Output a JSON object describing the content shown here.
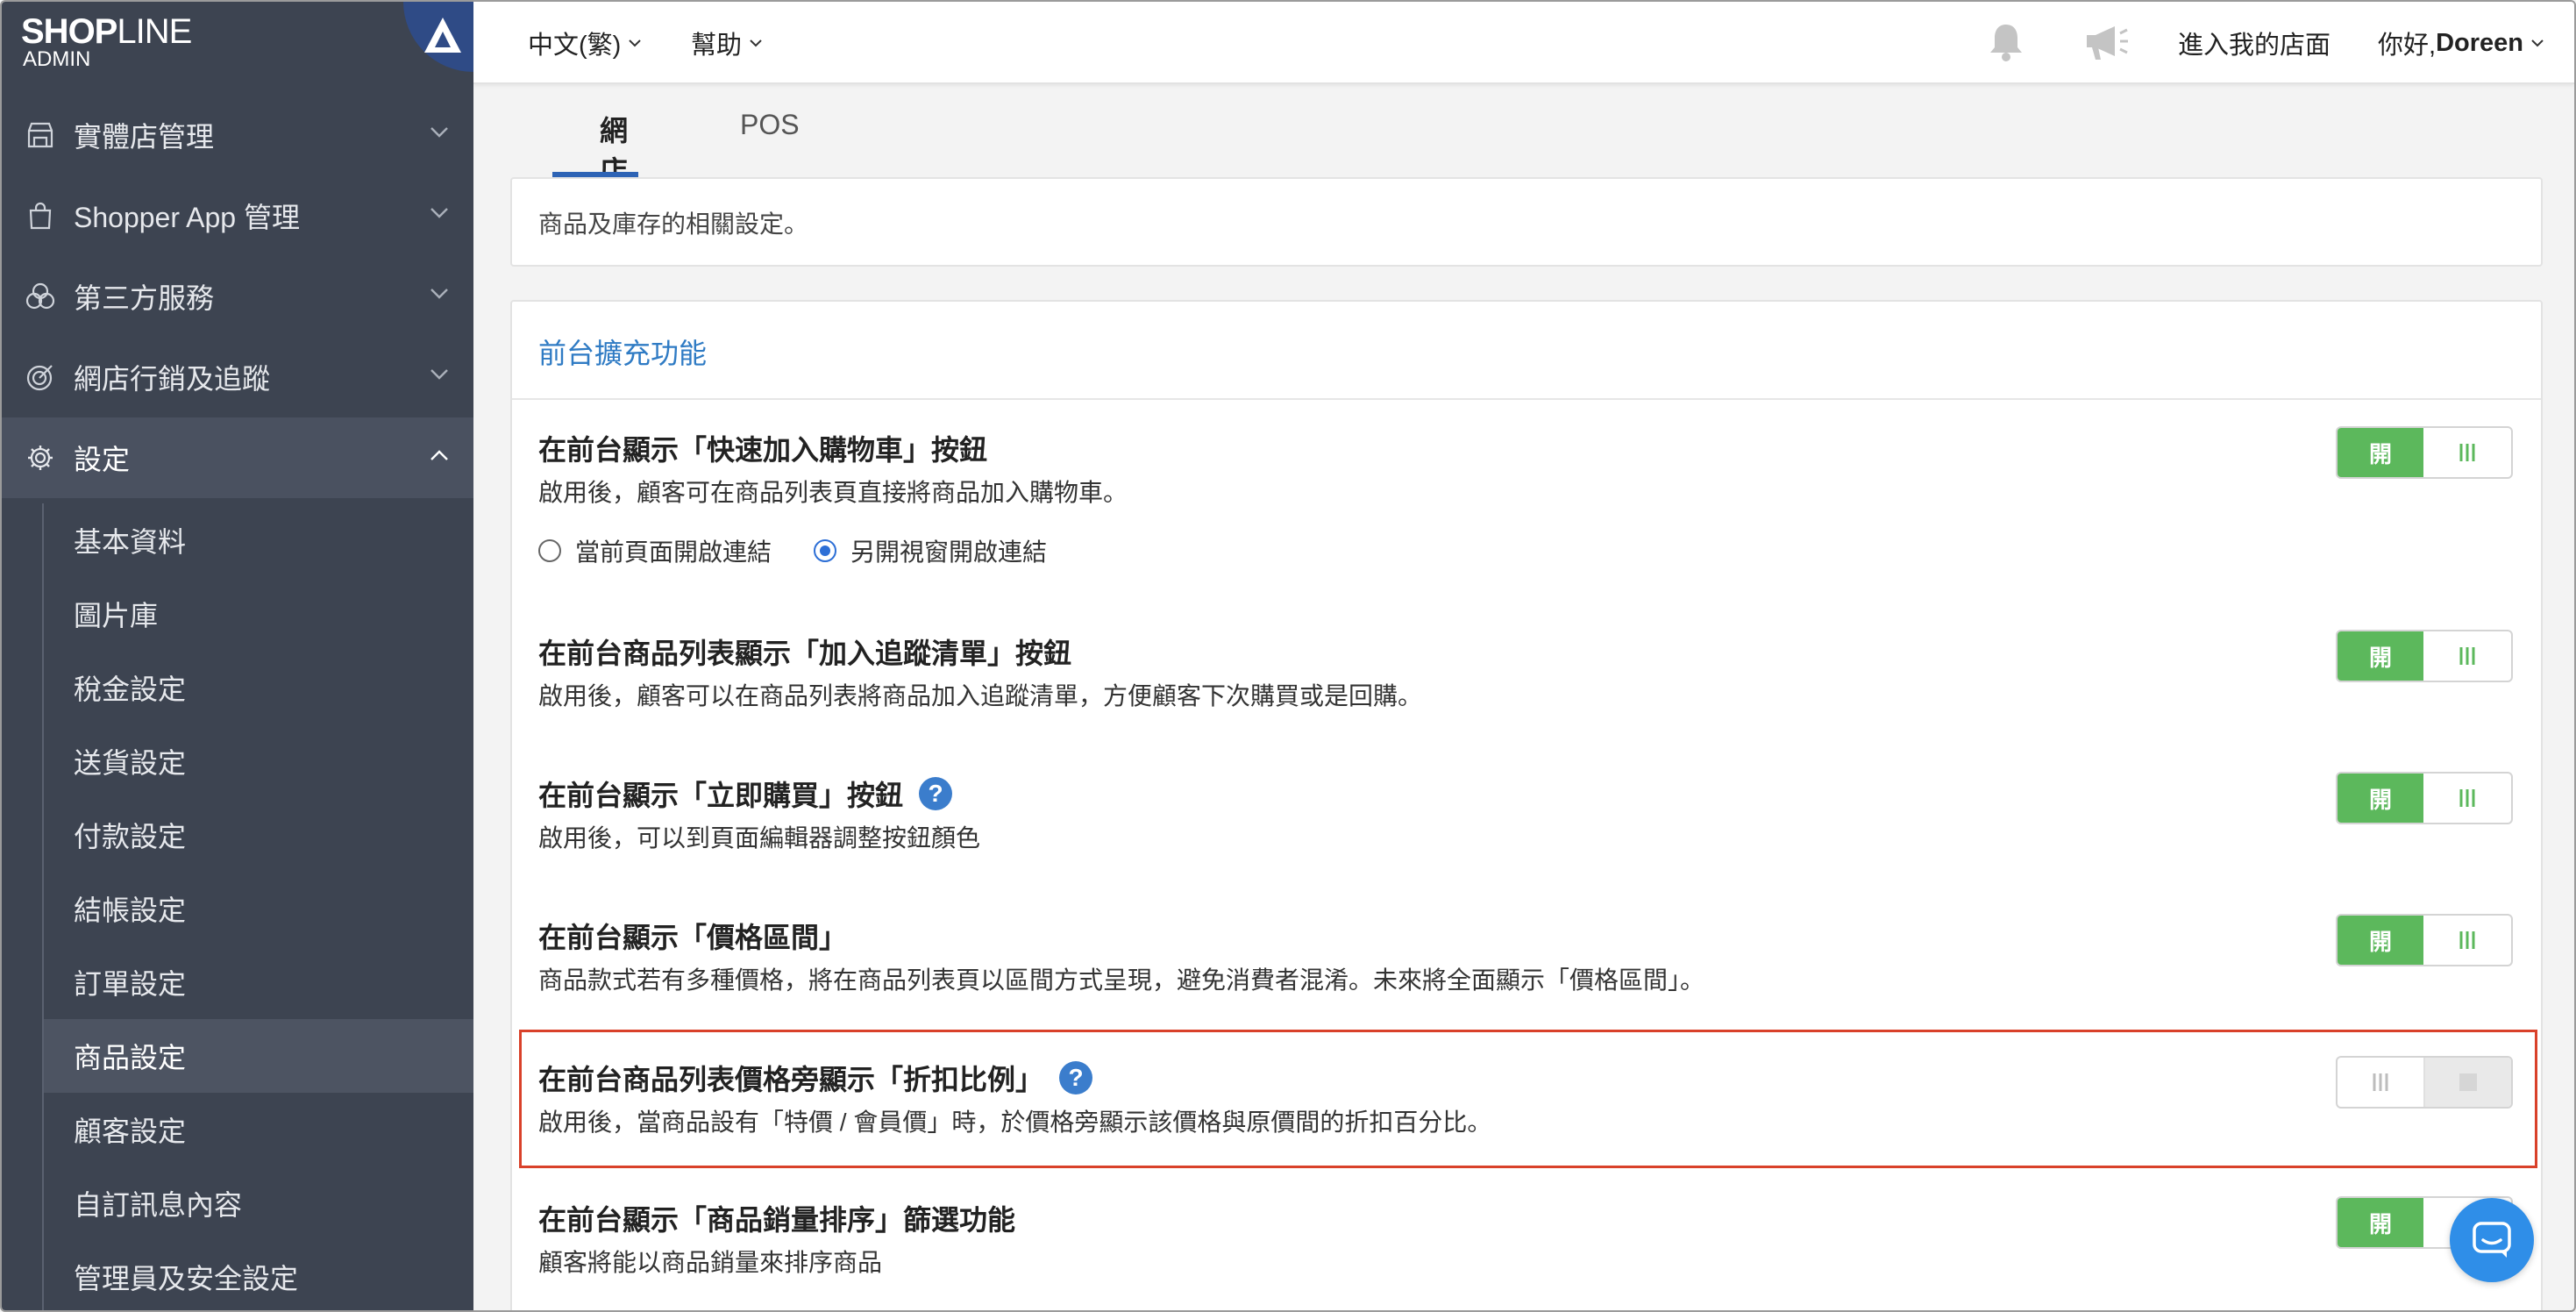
{
  "brand": {
    "logo_bold": "SHOP",
    "logo_light": "LINE",
    "logo_sub": "ADMIN",
    "brand_color": "#2f4b86"
  },
  "sidebar": {
    "items": [
      {
        "label": "實體店管理",
        "icon": "store-icon"
      },
      {
        "label": "Shopper App 管理",
        "icon": "shopping-bag-icon"
      },
      {
        "label": "第三方服務",
        "icon": "overlapping-circles-icon"
      },
      {
        "label": "網店行銷及追蹤",
        "icon": "target-icon"
      },
      {
        "label": "設定",
        "icon": "gear-icon"
      }
    ],
    "sub_items": [
      "基本資料",
      "圖片庫",
      "稅金設定",
      "送貨設定",
      "付款設定",
      "結帳設定",
      "訂單設定",
      "商品設定",
      "顧客設定",
      "自訂訊息內容",
      "管理員及安全設定"
    ],
    "active_sub": "商品設定"
  },
  "topbar": {
    "language": "中文(繁)",
    "help": "幫助",
    "enter_store": "進入我的店面",
    "greeting": "你好, ",
    "user_name": "Doreen"
  },
  "tabs": {
    "online": "網店",
    "pos": "POS"
  },
  "description": "商品及庫存的相關設定。",
  "section": {
    "title": "前台擴充功能",
    "rows": [
      {
        "title": "在前台顯示「快速加入購物車」按鈕",
        "desc": "啟用後，顧客可在商品列表頁直接將商品加入購物車。",
        "enabled": true
      },
      {
        "title": "在前台商品列表顯示「加入追蹤清單」按鈕",
        "desc": "啟用後，顧客可以在商品列表將商品加入追蹤清單，方便顧客下次購買或是回購。",
        "enabled": true
      },
      {
        "title": "在前台顯示「立即購買」按鈕",
        "desc": "啟用後，可以到頁面編輯器調整按鈕顏色",
        "enabled": true
      },
      {
        "title": "在前台顯示「價格區間」",
        "desc": "商品款式若有多種價格，將在商品列表頁以區間方式呈現，避免消費者混淆。未來將全面顯示「價格區間」。",
        "enabled": true
      },
      {
        "title": "在前台商品列表價格旁顯示「折扣比例」",
        "desc": "啟用後，當商品設有「特價 / 會員價」時，於價格旁顯示該價格與原價間的折扣百分比。",
        "enabled": false
      },
      {
        "title": "在前台顯示「商品銷量排序」篩選功能",
        "desc": "顧客將能以商品銷量來排序商品",
        "enabled": true
      }
    ],
    "radio": {
      "option1": "當前頁面開啟連結",
      "option2": "另開視窗開啟連結",
      "selected": "另開視窗開啟連結"
    }
  },
  "toggle_on_label": "開",
  "help_glyph": "?",
  "colors": {
    "toggle_on": "#5cb85c",
    "sidebar_bg": "#3d4451",
    "link_blue": "#2f7bc4",
    "highlight_red": "#d9412a",
    "chat_blue": "#2f8ee8"
  }
}
